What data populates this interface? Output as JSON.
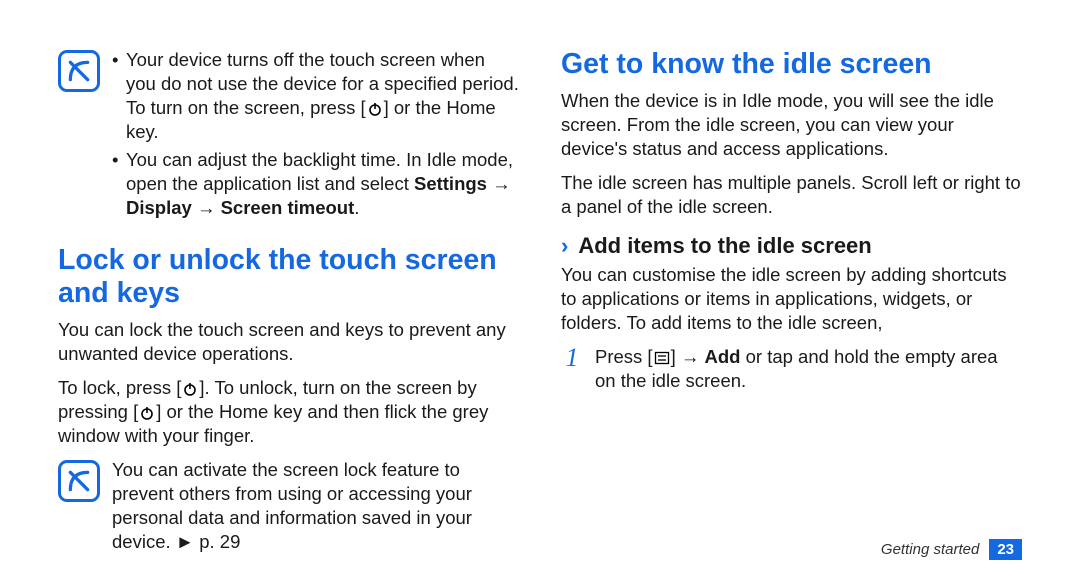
{
  "left": {
    "note1": {
      "b1_pre": "Your device turns off the touch screen when you do not use the device for a specified period. To turn on the screen, press [",
      "b1_post": "] or the Home key.",
      "b2_pre": "You can adjust the backlight time. In Idle mode, open the application list and select ",
      "b2_bold1": "Settings",
      "b2_arrow1": " → ",
      "b2_bold2": "Display",
      "b2_arrow2": " → ",
      "b2_bold3": "Screen timeout",
      "b2_post": "."
    },
    "h1": "Lock or unlock the touch screen and keys",
    "p1": "You can lock the touch screen and keys to prevent any unwanted device operations.",
    "p2_pre": "To lock, press [",
    "p2_mid": "]. To unlock, turn on the screen by pressing [",
    "p2_post": "] or the Home key and then flick the grey window with your finger.",
    "note2_pre": "You can activate the screen lock feature to prevent others from using or accessing your personal data and information saved in your device. ",
    "note2_tri": "►",
    "note2_post": " p. 29"
  },
  "right": {
    "h1": "Get to know the idle screen",
    "p1": "When the device is in Idle mode, you will see the idle screen. From the idle screen, you can view your device's status and access applications.",
    "p2": "The idle screen has multiple panels. Scroll left or right to a panel of the idle screen.",
    "sub_chevron": "›",
    "sub_label": "Add items to the idle screen",
    "p3": "You can customise the idle screen by adding shortcuts to applications or items in applications, widgets, or folders. To add items to the idle screen,",
    "step1_num": "1",
    "step1_pre": "Press [",
    "step1_mid": "] → ",
    "step1_bold": "Add",
    "step1_post": " or tap and hold the empty area on the idle screen."
  },
  "footer": {
    "section": "Getting started",
    "page": "23"
  }
}
